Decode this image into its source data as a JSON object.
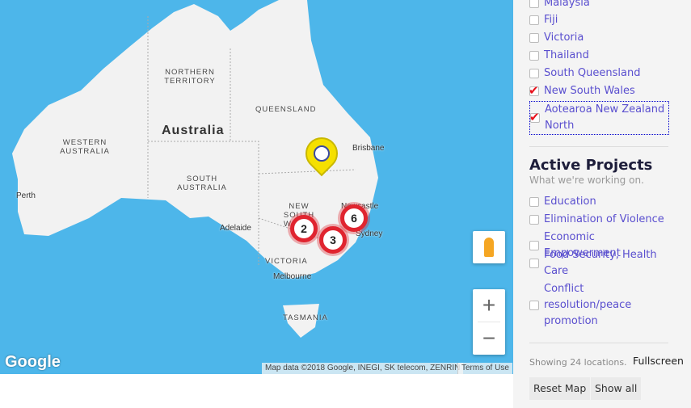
{
  "map": {
    "country_label": "Australia",
    "region_labels": [
      "NORTHERN TERRITORY",
      "QUEENSLAND",
      "WESTERN AUSTRALIA",
      "SOUTH AUSTRALIA",
      "NEW SOUTH WALES",
      "VICTORIA",
      "TASMANIA"
    ],
    "cities": [
      "Brisbane",
      "Perth",
      "Adelaide",
      "Melbourne",
      "Sydney",
      "Newcastle"
    ],
    "clusters": [
      "2",
      "3",
      "6"
    ],
    "attribution": "Map data ©2018 Google, INEGI, SK telecom, ZENRIN",
    "terms": "Terms of Use",
    "logo": "Google",
    "zoom_in": "+",
    "zoom_out": "−",
    "colors": {
      "ocean": "#4db6ea",
      "land": "#f2f2f2",
      "cluster": "#e0242f",
      "marker": "#f5e000"
    }
  },
  "sidebar": {
    "regions": [
      {
        "label": "Malaysia",
        "checked": false
      },
      {
        "label": "Fiji",
        "checked": false
      },
      {
        "label": "Victoria",
        "checked": false
      },
      {
        "label": "Thailand",
        "checked": false
      },
      {
        "label": "South Queensland",
        "checked": false
      },
      {
        "label": "New South Wales",
        "checked": true
      },
      {
        "label": "Aotearoa New Zealand North",
        "checked": true
      }
    ],
    "projects_title": "Active Projects",
    "projects_subtitle": "What we're working on.",
    "projects": [
      {
        "label": "Education",
        "checked": false
      },
      {
        "label": "Elimination of Violence",
        "checked": false
      },
      {
        "label": "Economic Empowerment",
        "checked": false
      },
      {
        "label": "Food Security, Health Care",
        "checked": false
      },
      {
        "label": "Conflict resolution/peace promotion",
        "checked": false
      }
    ],
    "showing": "Showing 24 locations.",
    "fullscreen": "Fullscreen",
    "reset": "Reset Map",
    "show_all": "Show all"
  }
}
